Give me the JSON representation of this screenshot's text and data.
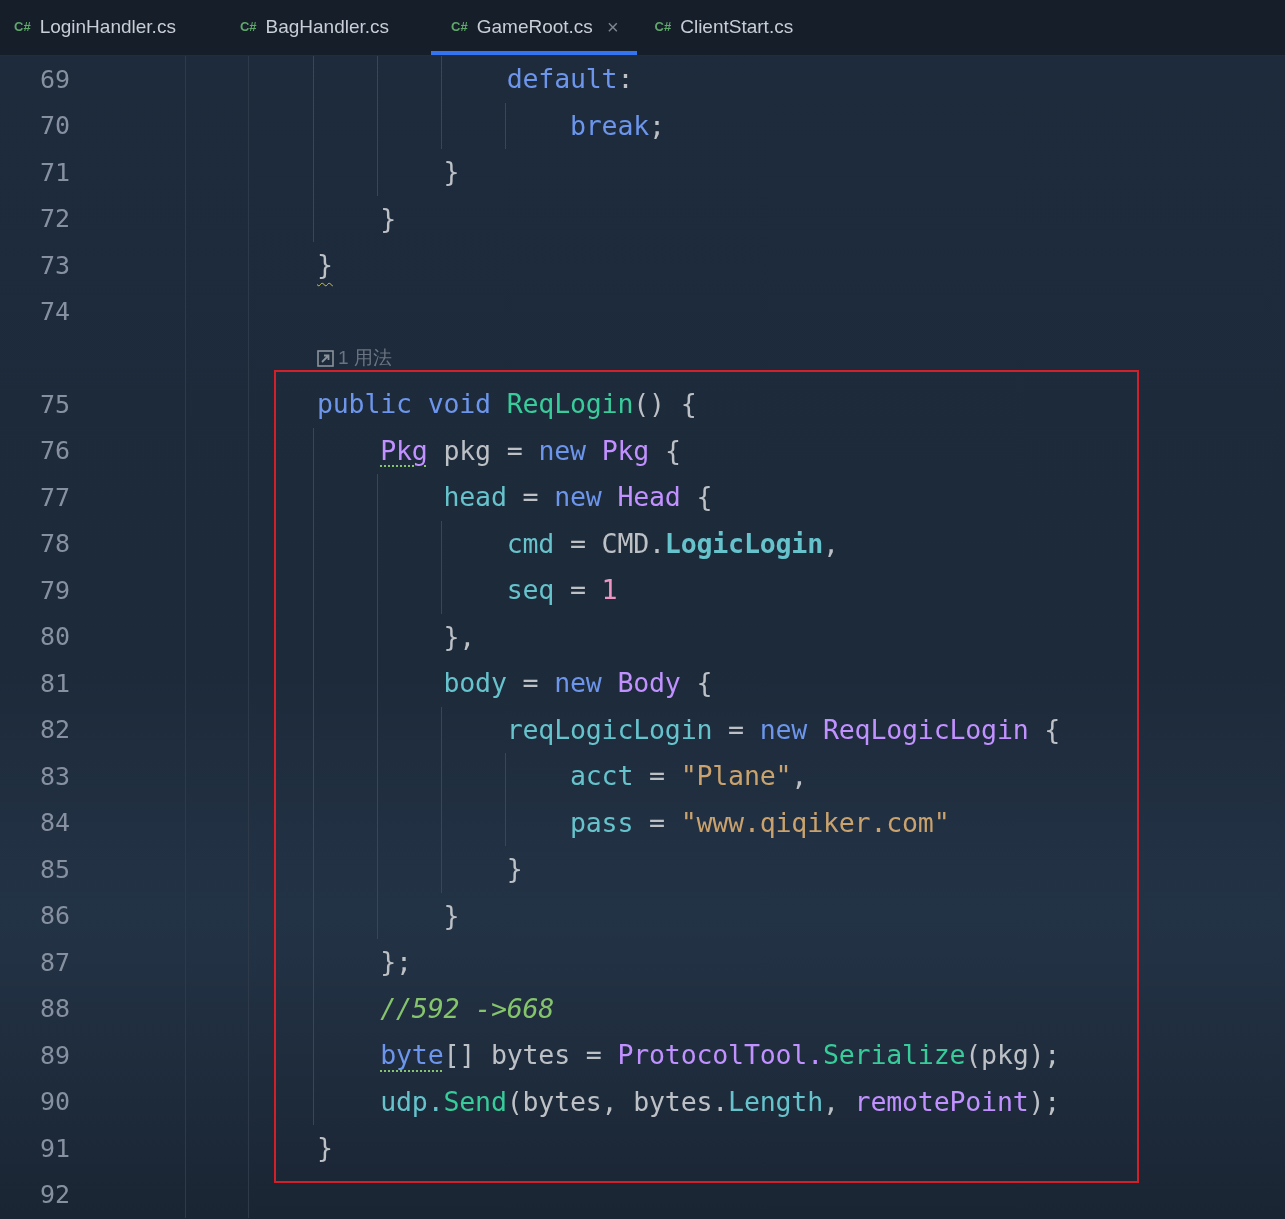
{
  "tabs": [
    {
      "icon_text": "C#",
      "label": "LoginHandler.cs",
      "selected": false
    },
    {
      "icon_text": "C#",
      "label": "BagHandler.cs",
      "selected": false
    },
    {
      "icon_text": "C#",
      "label": "GameRoot.cs",
      "selected": true,
      "close_glyph": "×"
    },
    {
      "icon_text": "C#",
      "label": "ClientStart.cs",
      "selected": false
    }
  ],
  "lines": [
    {
      "number": "69",
      "highlighted": false,
      "tokens": [
        {
          "text": "            default",
          "kind": "keyword"
        },
        {
          "text": ":",
          "kind": "plain"
        }
      ]
    },
    {
      "number": "70",
      "highlighted": false,
      "tokens": [
        {
          "text": "                break",
          "kind": "keyword"
        },
        {
          "text": ";",
          "kind": "plain"
        }
      ]
    },
    {
      "number": "71",
      "highlighted": false,
      "tokens": [
        {
          "text": "        }",
          "kind": "plain"
        }
      ]
    },
    {
      "number": "72",
      "highlighted": false,
      "tokens": [
        {
          "text": "    }",
          "kind": "plain"
        }
      ]
    },
    {
      "number": "73",
      "highlighted": false,
      "tokens": [
        {
          "text": "}",
          "kind": "warned"
        }
      ]
    },
    {
      "number": "74",
      "highlighted": false
    },
    {
      "number": "75",
      "highlighted": true,
      "usage_hint": "1 用法",
      "tokens": [
        {
          "text": "public void ",
          "kind": "keyword"
        },
        {
          "text": "ReqLogin",
          "kind": "method"
        },
        {
          "text": "() {",
          "kind": "plain"
        }
      ]
    },
    {
      "number": "76",
      "highlighted": true,
      "tokens": [
        {
          "text": "    Pkg",
          "kind": "type-warned"
        },
        {
          "text": " pkg = ",
          "kind": "plain"
        },
        {
          "text": "new ",
          "kind": "keyword"
        },
        {
          "text": "Pkg",
          "kind": "type"
        },
        {
          "text": " {",
          "kind": "plain"
        }
      ]
    },
    {
      "number": "77",
      "highlighted": true,
      "tokens": [
        {
          "text": "        head",
          "kind": "field"
        },
        {
          "text": " = ",
          "kind": "plain"
        },
        {
          "text": "new ",
          "kind": "keyword"
        },
        {
          "text": "Head",
          "kind": "type"
        },
        {
          "text": " {",
          "kind": "plain"
        }
      ]
    },
    {
      "number": "78",
      "highlighted": true,
      "tokens": [
        {
          "text": "            cmd",
          "kind": "field"
        },
        {
          "text": " = CMD.",
          "kind": "plain"
        },
        {
          "text": "LogicLogin",
          "kind": "constant"
        },
        {
          "text": ",",
          "kind": "plain"
        }
      ]
    },
    {
      "number": "79",
      "highlighted": true,
      "tokens": [
        {
          "text": "            seq",
          "kind": "field"
        },
        {
          "text": " = ",
          "kind": "plain"
        },
        {
          "text": "1",
          "kind": "number"
        }
      ]
    },
    {
      "number": "80",
      "highlighted": true,
      "tokens": [
        {
          "text": "        },",
          "kind": "plain"
        }
      ]
    },
    {
      "number": "81",
      "highlighted": true,
      "tokens": [
        {
          "text": "        body",
          "kind": "field"
        },
        {
          "text": " = ",
          "kind": "plain"
        },
        {
          "text": "new ",
          "kind": "keyword"
        },
        {
          "text": "Body",
          "kind": "type"
        },
        {
          "text": " {",
          "kind": "plain"
        }
      ]
    },
    {
      "number": "82",
      "highlighted": true,
      "tokens": [
        {
          "text": "            reqLogicLogin",
          "kind": "field"
        },
        {
          "text": " = ",
          "kind": "plain"
        },
        {
          "text": "new ",
          "kind": "keyword"
        },
        {
          "text": "ReqLogicLogin",
          "kind": "type"
        },
        {
          "text": " {",
          "kind": "plain"
        }
      ]
    },
    {
      "number": "83",
      "highlighted": true,
      "tokens": [
        {
          "text": "                acct",
          "kind": "field"
        },
        {
          "text": " = ",
          "kind": "plain"
        },
        {
          "text": "\"Plane\"",
          "kind": "string"
        },
        {
          "text": ",",
          "kind": "plain"
        }
      ]
    },
    {
      "number": "84",
      "highlighted": true,
      "tokens": [
        {
          "text": "                pass",
          "kind": "field"
        },
        {
          "text": " = ",
          "kind": "plain"
        },
        {
          "text": "\"www.qiqiker.com\"",
          "kind": "string"
        }
      ]
    },
    {
      "number": "85",
      "highlighted": true,
      "tokens": [
        {
          "text": "            }",
          "kind": "plain"
        }
      ]
    },
    {
      "number": "86",
      "highlighted": true,
      "tokens": [
        {
          "text": "        }",
          "kind": "plain"
        }
      ]
    },
    {
      "number": "87",
      "highlighted": true,
      "tokens": [
        {
          "text": "    };",
          "kind": "plain"
        }
      ]
    },
    {
      "number": "88",
      "highlighted": true,
      "tokens": [
        {
          "text": "    //592 ->668",
          "kind": "comment"
        }
      ]
    },
    {
      "number": "89",
      "highlighted": true,
      "tokens": [
        {
          "text": "    byte",
          "kind": "keyword-warned"
        },
        {
          "text": "[] bytes = ",
          "kind": "plain"
        },
        {
          "text": "ProtocolTool.",
          "kind": "type"
        },
        {
          "text": "Serialize",
          "kind": "method"
        },
        {
          "text": "(pkg);",
          "kind": "plain"
        }
      ]
    },
    {
      "number": "90",
      "highlighted": true,
      "tokens": [
        {
          "text": "    udp.",
          "kind": "field"
        },
        {
          "text": "Send",
          "kind": "method"
        },
        {
          "text": "(bytes, bytes.",
          "kind": "plain"
        },
        {
          "text": "Length",
          "kind": "field"
        },
        {
          "text": ", ",
          "kind": "plain"
        },
        {
          "text": "remotePoint",
          "kind": "member"
        },
        {
          "text": ");",
          "kind": "plain"
        }
      ]
    },
    {
      "number": "91",
      "highlighted": true,
      "tokens": [
        {
          "text": "}",
          "kind": "plain"
        }
      ]
    },
    {
      "number": "92",
      "highlighted": false
    }
  ]
}
